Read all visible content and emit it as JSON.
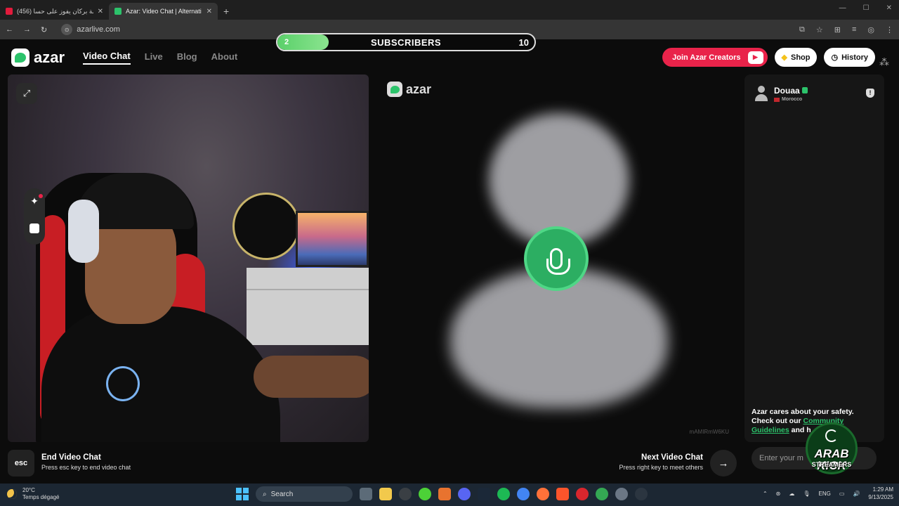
{
  "browser": {
    "tabs": [
      {
        "title": "نهضة بركان يفوز على حسا (456)",
        "active": false,
        "color": "#e21b3c"
      },
      {
        "title": "Azar: Video Chat | Alternati",
        "active": true,
        "color": "#2cc36b"
      }
    ],
    "url": "azarlive.com"
  },
  "subscribers": {
    "current": "2",
    "label": "SUBSCRIBERS",
    "goal": "10",
    "progress": 0.2
  },
  "nav": {
    "brand": "azar",
    "links": [
      {
        "label": "Video Chat",
        "active": true
      },
      {
        "label": "Live",
        "active": false
      },
      {
        "label": "Blog",
        "active": false
      },
      {
        "label": "About",
        "active": false
      }
    ],
    "join_creators": "Join Azar Creators",
    "shop": "Shop",
    "history": "History"
  },
  "remote": {
    "brand": "azar",
    "watermark": "mAMIRmW6KU"
  },
  "chat": {
    "peer_name": "Douaa",
    "peer_country": "Morocco",
    "safety_line1": "Azar cares about your safety.",
    "safety_line2": "Check out our",
    "safety_link": "Community Guidelines",
    "safety_line3": "and h",
    "input_placeholder": "Enter your m"
  },
  "controls": {
    "esc_key": "esc",
    "end_title": "End Video Chat",
    "end_sub": "Press esc key to end video chat",
    "next_title": "Next Video Chat",
    "next_sub": "Press right key to meet others"
  },
  "badge": {
    "line1": "ARAB KICK",
    "line2": "STREAMERS"
  },
  "taskbar": {
    "temp": "20°C",
    "weather": "Temps dégagé",
    "search": "Search",
    "lang": "ENG",
    "time": "1:29 AM",
    "date": "9/13/2025"
  },
  "colors": {
    "accent": "#2cc36b",
    "creators": "#e9234a"
  }
}
